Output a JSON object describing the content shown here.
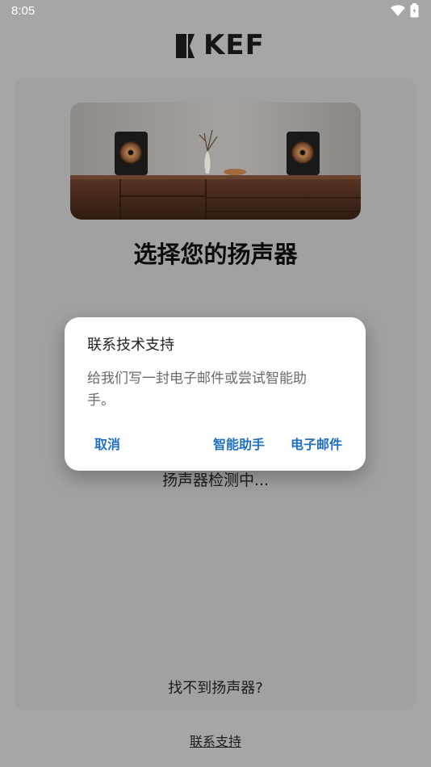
{
  "status_bar": {
    "time": "8:05"
  },
  "brand": {
    "logo_text": "KEF"
  },
  "main": {
    "title": "选择您的扬声器",
    "detecting": "扬声器检测中...",
    "cant_find": "找不到扬声器?",
    "contact_support": "联系支持"
  },
  "dialog": {
    "title": "联系技术支持",
    "message": "给我们写一封电子邮件或尝试智能助手。",
    "buttons": {
      "cancel": "取消",
      "assistant": "智能助手",
      "email": "电子邮件"
    }
  },
  "colors": {
    "accent": "#1f6fc6",
    "overlay_background": "#a6a6a6"
  }
}
